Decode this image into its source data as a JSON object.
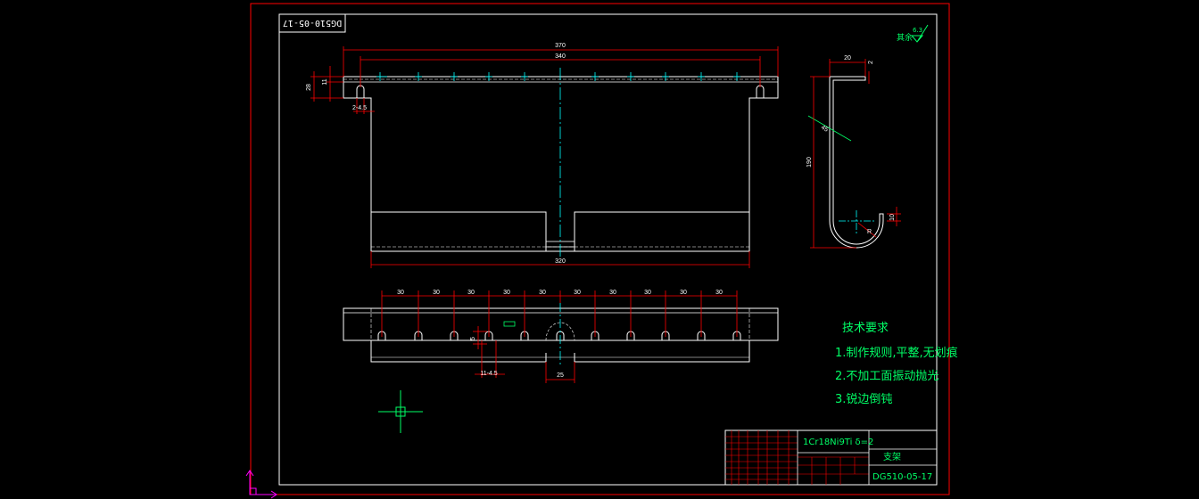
{
  "drawing_number_rotated": "DG510-05-17",
  "surface_note": {
    "label": "其余",
    "value": "6.3"
  },
  "front_view": {
    "dim_overall": "370",
    "dim_holes_span": "340",
    "dim_height_left": "28",
    "dim_height_right": "11",
    "dim_slot": "2-4.5",
    "dim_bottom": "320"
  },
  "side_view": {
    "dim_width": "20",
    "dim_thickness": "2",
    "dim_height": "190",
    "dim_lip": "10",
    "dim_radius": "R",
    "angle_mark": "45"
  },
  "bottom_view": {
    "spacing_labels": [
      "30",
      "30",
      "30",
      "30",
      "30",
      "30",
      "30",
      "30",
      "30",
      "30"
    ],
    "dim_hole_small": "5",
    "dim_holes": "11-4.5",
    "dim_center": "25"
  },
  "tech_requirements": {
    "title": "技术要求",
    "items": [
      "1.制作规则,平整,无划痕",
      "2.不加工面振动抛光",
      "3.锐边倒钝"
    ]
  },
  "title_block": {
    "material": "1Cr18Ni9Ti  δ=2",
    "part_name": "支架",
    "drawing_number": "DG510-05-17"
  },
  "colors": {
    "outer_frame": "#ff0000",
    "inner_frame": "#ffffff",
    "dimension": "#ff0000",
    "centerline": "#00ffff",
    "text_notes": "#00ff66",
    "ucs_icon": "#ff00ff"
  }
}
